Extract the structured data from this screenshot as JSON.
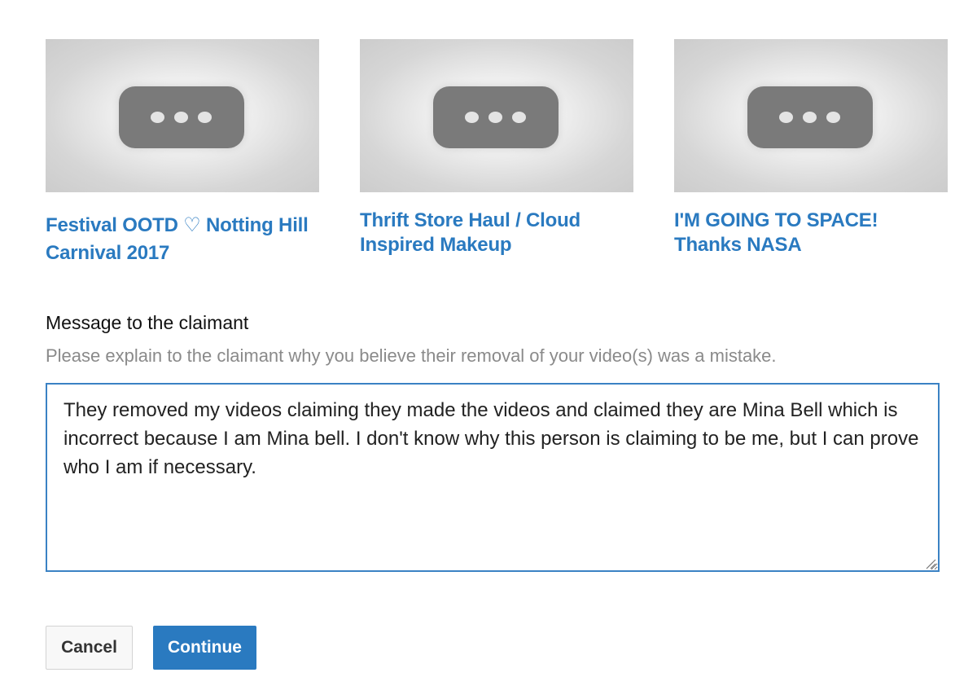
{
  "videos": [
    {
      "title": "Festival OOTD ♡ Notting Hill Carnival 2017",
      "thumbnail_icon": "more-dots-icon"
    },
    {
      "title": "Thrift Store Haul / Cloud Inspired Makeup",
      "thumbnail_icon": "more-dots-icon"
    },
    {
      "title": "I'M GOING TO SPACE! Thanks NASA",
      "thumbnail_icon": "more-dots-icon"
    }
  ],
  "message": {
    "label": "Message to the claimant",
    "help": "Please explain to the claimant why you believe their removal of your video(s) was a mistake.",
    "value": "They removed my videos claiming they made the videos and claimed they are Mina Bell which is incorrect because I am Mina bell. I don't know why this person is claiming to be me, but I can prove who I am if necessary."
  },
  "actions": {
    "cancel_label": "Cancel",
    "continue_label": "Continue"
  },
  "colors": {
    "link": "#2a7ac0",
    "primary_button": "#2a7ac0",
    "input_border": "#3b82c4",
    "help_text": "#8a8a8a"
  }
}
